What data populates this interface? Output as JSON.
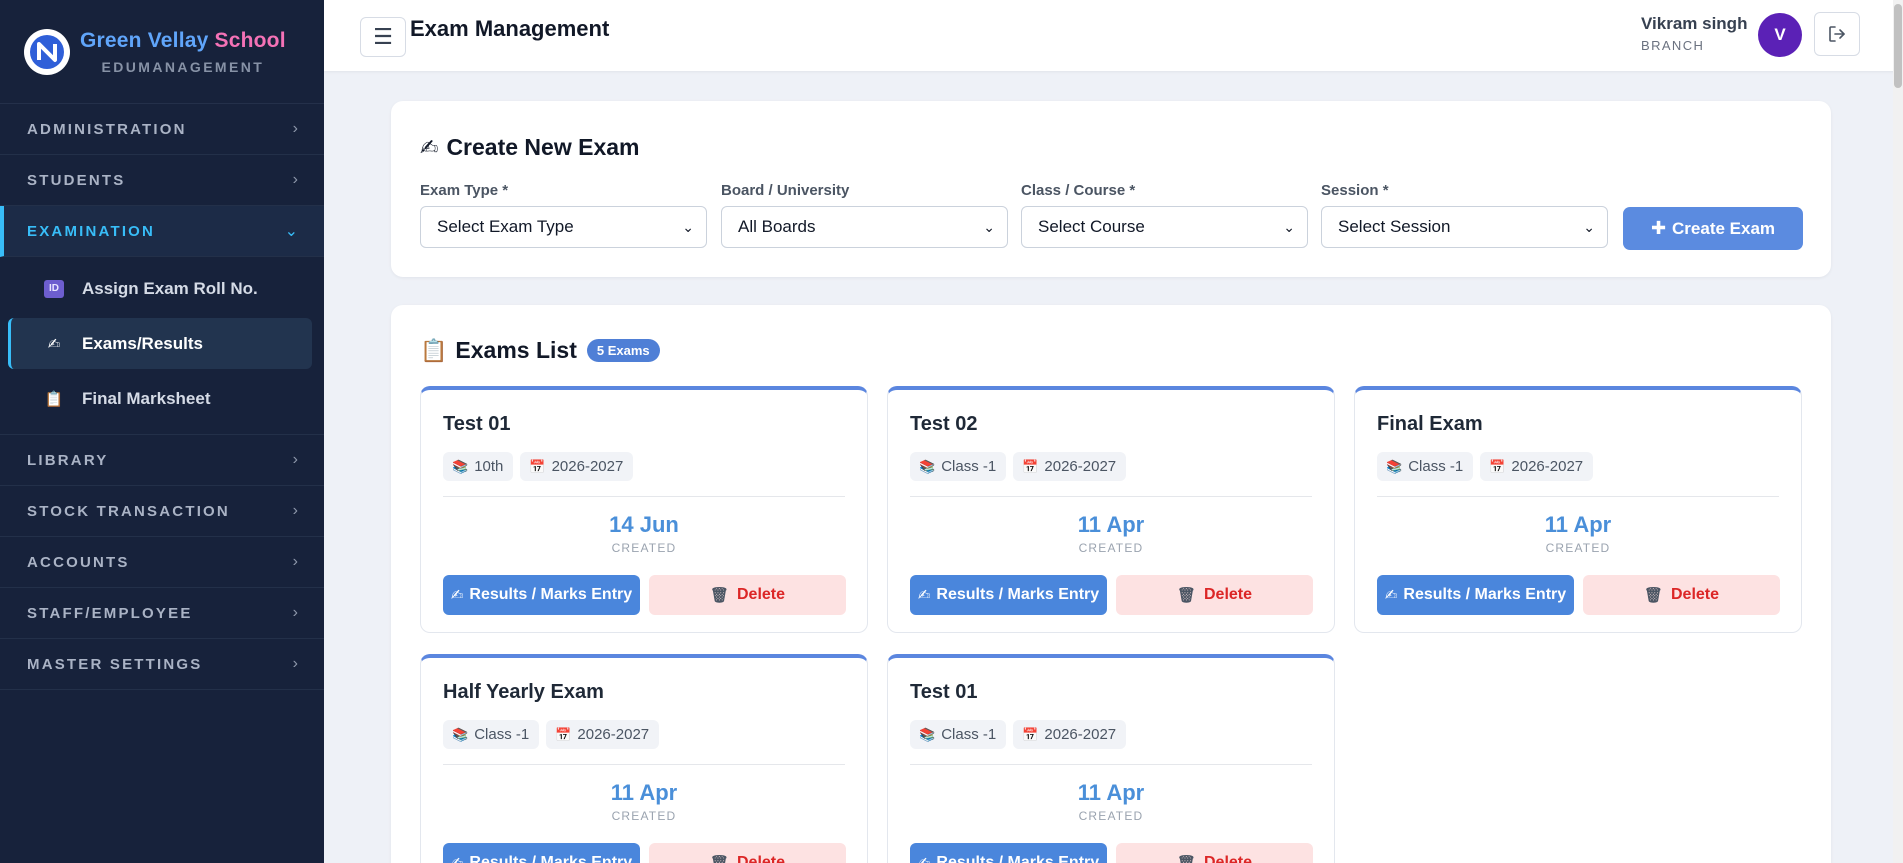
{
  "brand": {
    "name_part1": "Green Vellay",
    "name_part2": "School",
    "subtitle": "EDUMANAGEMENT"
  },
  "sidebar": {
    "items": [
      {
        "label": "ADMINISTRATION"
      },
      {
        "label": "STUDENTS"
      },
      {
        "label": "EXAMINATION"
      },
      {
        "label": "LIBRARY"
      },
      {
        "label": "STOCK TRANSACTION"
      },
      {
        "label": "ACCOUNTS"
      },
      {
        "label": "STAFF/EMPLOYEE"
      },
      {
        "label": "MASTER SETTINGS"
      }
    ],
    "examination_sub": [
      {
        "label": "Assign Exam Roll No.",
        "icon": "id-card-icon"
      },
      {
        "label": "Exams/Results",
        "icon": "writing-hand-icon"
      },
      {
        "label": "Final Marksheet",
        "icon": "clipboard-icon"
      }
    ],
    "id_badge_text": "ID"
  },
  "header": {
    "title": "Exam Management",
    "user_name": "Vikram singh",
    "user_role": "BRANCH",
    "avatar_initial": "V"
  },
  "create_exam": {
    "title": "Create New Exam",
    "fields": [
      {
        "label": "Exam Type *",
        "value": "Select Exam Type"
      },
      {
        "label": "Board / University",
        "value": "All Boards"
      },
      {
        "label": "Class / Course *",
        "value": "Select Course"
      },
      {
        "label": "Session *",
        "value": "Select Session"
      }
    ],
    "button_label": "Create Exam"
  },
  "exams_list": {
    "title": "Exams List",
    "count_badge": "5 Exams",
    "created_label": "CREATED",
    "results_label": "Results / Marks Entry",
    "delete_label": "Delete",
    "exams": [
      {
        "name": "Test 01",
        "class": "10th",
        "session": "2026-2027",
        "date": "14 Jun"
      },
      {
        "name": "Test 02",
        "class": "Class -1",
        "session": "2026-2027",
        "date": "11 Apr"
      },
      {
        "name": "Final Exam",
        "class": "Class -1",
        "session": "2026-2027",
        "date": "11 Apr"
      },
      {
        "name": "Half Yearly Exam",
        "class": "Class -1",
        "session": "2026-2027",
        "date": "11 Apr"
      },
      {
        "name": "Test 01",
        "class": "Class -1",
        "session": "2026-2027",
        "date": "11 Apr"
      }
    ]
  },
  "colors": {
    "sidebar_bg": "#17223b",
    "accent": "#38bdf8",
    "primary_button": "#4a86dc",
    "delete_bg": "#fde2e2",
    "delete_text": "#dc2626",
    "avatar": "#5b21b6"
  }
}
